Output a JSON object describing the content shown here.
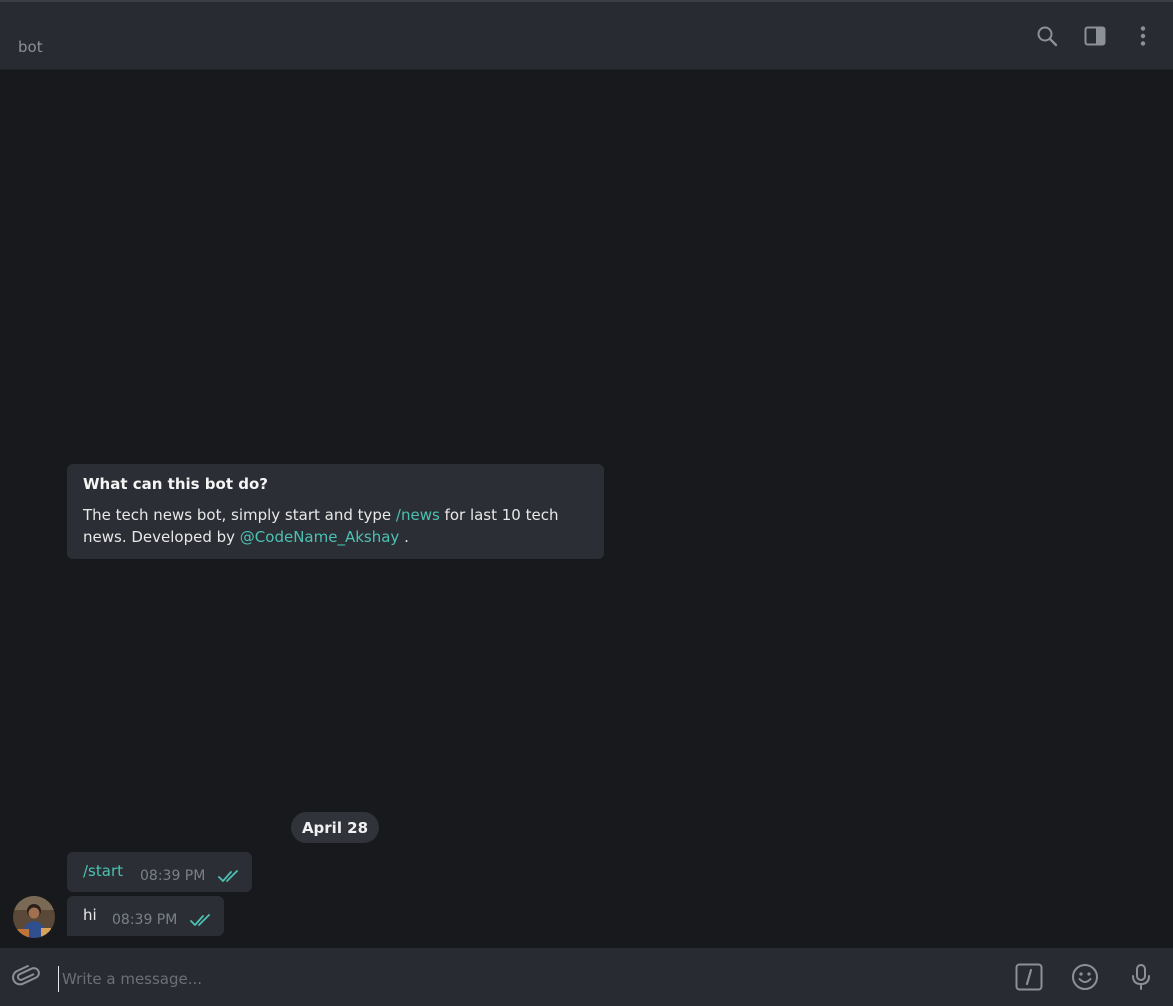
{
  "header": {
    "title": "bot",
    "icons": [
      "search-icon",
      "sidebar-toggle-icon",
      "more-vertical-icon"
    ]
  },
  "bot_info": {
    "title": "What can this bot do?",
    "text_before": "The tech news bot, simply start and type ",
    "command_link": "/news",
    "text_middle": " for last 10 tech news. Developed by ",
    "mention_link": "@CodeName_Akshay",
    "text_after": " ."
  },
  "date_separator": "April 28",
  "messages": [
    {
      "text": "/start",
      "time": "08:39 PM",
      "status": "read"
    },
    {
      "text": "hi",
      "time": "08:39 PM",
      "status": "read"
    }
  ],
  "composer": {
    "placeholder": "Write a message...",
    "icons": [
      "attach-icon",
      "bot-command-icon",
      "emoji-icon",
      "microphone-icon"
    ]
  },
  "colors": {
    "accent": "#4cc1b3",
    "header_bg": "#282b31",
    "chat_bg": "#18191d",
    "bubble_bg": "#2b2e34"
  }
}
